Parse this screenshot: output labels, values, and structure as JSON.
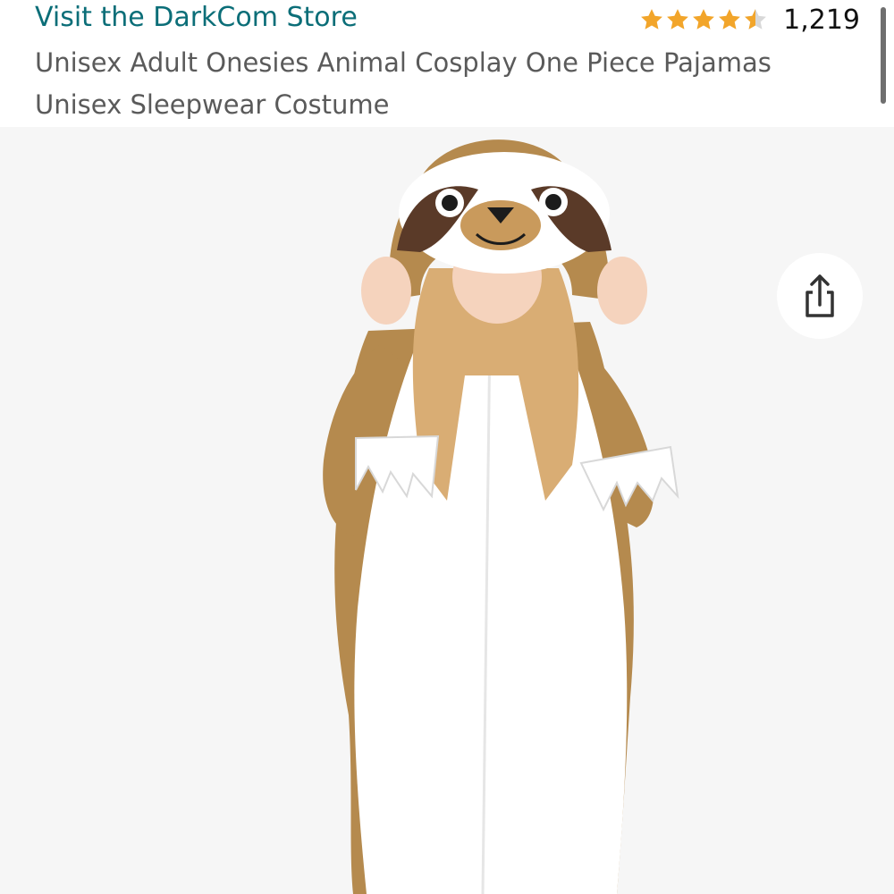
{
  "product": {
    "store_link": "Visit the DarkCom Store",
    "rating": {
      "value": 4.5,
      "max": 5,
      "count": "1,219",
      "star_color": "#f2a52a",
      "empty_star_color": "#d8d8d8"
    },
    "title_lines": [
      "Unisex Adult Onesies Animal Cosplay One Piece Pajamas",
      "Unisex Sleepwear Costume"
    ],
    "colors": {
      "store_link": "#0b6e78",
      "title": "#5a5a5a",
      "image_background": "#f6f6f6"
    }
  },
  "image": {
    "content": "sloth onesie costume"
  },
  "share": {
    "icon": "share-icon"
  }
}
